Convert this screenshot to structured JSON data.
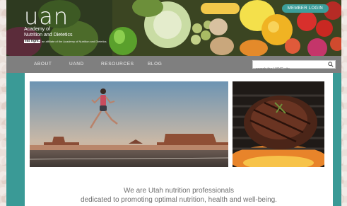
{
  "header": {
    "logo_text": "uan",
    "logo_line1": "Academy of",
    "logo_line2": "Nutrition and Dietetics",
    "logo_small": "an affiliate of the Academy of Nutrition and Dietetics",
    "logo_badge": "eat right.",
    "member_login_label": "MEMBER LOGIN"
  },
  "nav": {
    "items": [
      {
        "label": "ABOUT"
      },
      {
        "label": "UAND"
      },
      {
        "label": "RESOURCES"
      },
      {
        "label": "BLOG"
      }
    ],
    "search_placeholder": "search the UAND site"
  },
  "main": {
    "tagline_line1": "We are Utah nutrition professionals",
    "tagline_line2": "dedicated to promoting optimal nutrition, health and well-being."
  },
  "colors": {
    "teal": "#3a9a96",
    "nav_gray": "#7f7f7f",
    "tagline_gray": "#6d6d6d"
  }
}
